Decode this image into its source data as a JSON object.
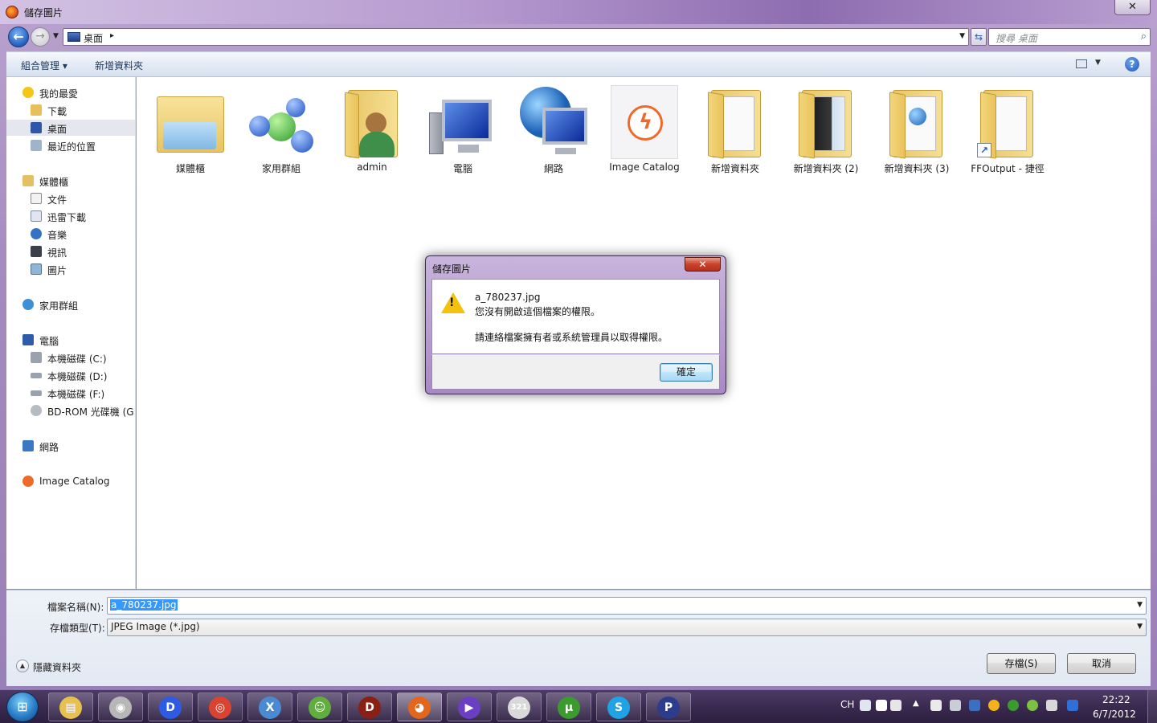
{
  "window": {
    "title": "儲存圖片",
    "close_glyph": "✕"
  },
  "navigation": {
    "back_glyph": "←",
    "forward_glyph": "→",
    "address": "桌面",
    "address_sep": "▸",
    "search_placeholder": "搜尋 桌面"
  },
  "toolbar": {
    "organize": "組合管理 ▾",
    "new_folder": "新增資料夾",
    "help": "?"
  },
  "sidebar": {
    "favorites": [
      {
        "label": "我的最愛",
        "icon": "star-icon"
      },
      {
        "label": "下載",
        "icon": "download-folder-icon"
      },
      {
        "label": "桌面",
        "icon": "desktop-icon",
        "selected": true
      },
      {
        "label": "最近的位置",
        "icon": "recent-places-icon"
      }
    ],
    "libraries": [
      {
        "label": "媒體櫃",
        "icon": "library-icon"
      },
      {
        "label": "文件",
        "icon": "documents-icon"
      },
      {
        "label": "迅雷下載",
        "icon": "thunder-download-icon"
      },
      {
        "label": "音樂",
        "icon": "music-icon"
      },
      {
        "label": "視訊",
        "icon": "video-icon"
      },
      {
        "label": "圖片",
        "icon": "pictures-icon"
      }
    ],
    "homegroup": {
      "label": "家用群組",
      "icon": "homegroup-icon"
    },
    "computer": [
      {
        "label": "電腦",
        "icon": "computer-icon"
      },
      {
        "label": "本機磁碟 (C:)",
        "icon": "drive-c-icon"
      },
      {
        "label": "本機磁碟 (D:)",
        "icon": "drive-d-icon"
      },
      {
        "label": "本機磁碟 (F:)",
        "icon": "drive-f-icon"
      },
      {
        "label": "BD-ROM 光碟機 (G:",
        "icon": "bd-rom-icon"
      }
    ],
    "network": {
      "label": "網路",
      "icon": "network-icon"
    },
    "image_catalog": {
      "label": "Image Catalog",
      "icon": "image-catalog-icon"
    }
  },
  "files": [
    {
      "label": "媒體櫃",
      "icon": "library-folder-icon"
    },
    {
      "label": "家用群組",
      "icon": "homegroup-icon"
    },
    {
      "label": "admin",
      "icon": "user-folder-icon"
    },
    {
      "label": "電腦",
      "icon": "computer-icon"
    },
    {
      "label": "網路",
      "icon": "network-icon"
    },
    {
      "label": "Image Catalog",
      "icon": "image-catalog-icon"
    },
    {
      "label": "新增資料夾",
      "icon": "folder-icon"
    },
    {
      "label": "新增資料夾 (2)",
      "icon": "folder-icon"
    },
    {
      "label": "新增資料夾 (3)",
      "icon": "folder-icon"
    },
    {
      "label": "FFOutput - 捷徑",
      "icon": "folder-shortcut-icon"
    }
  ],
  "save_form": {
    "filename_label": "檔案名稱(N):",
    "filename_value": "a_780237.jpg",
    "type_label": "存檔類型(T):",
    "type_value": "JPEG Image (*.jpg)",
    "hide_folders": "隱藏資料夾",
    "save_button": "存檔(S)",
    "cancel_button": "取消"
  },
  "dialog": {
    "title": "儲存圖片",
    "filename": "a_780237.jpg",
    "message": "您沒有開啟這個檔案的權限。",
    "detail": "請連絡檔案擁有者或系統管理員以取得權限。",
    "ok_button": "確定",
    "close_glyph": "✕",
    "warning_mark": "!"
  },
  "taskbar": {
    "start_glyph": "⊞",
    "apps": [
      {
        "name": "windows-explorer-icon",
        "glyph": "▤",
        "color": "#e8c04f"
      },
      {
        "name": "cleaning-app-icon",
        "glyph": "◉",
        "color": "#b7b7b7"
      },
      {
        "name": "media-player-d-icon",
        "glyph": "D",
        "color": "#2d5be3"
      },
      {
        "name": "chrome-icon",
        "glyph": "◎",
        "color": "#d9432f"
      },
      {
        "name": "x-app-icon",
        "glyph": "X",
        "color": "#4a8ad2"
      },
      {
        "name": "messenger-icon",
        "glyph": "☺",
        "color": "#5fae3e"
      },
      {
        "name": "diablo-icon",
        "glyph": "D",
        "color": "#8a1f14"
      },
      {
        "name": "firefox-icon",
        "glyph": "◕",
        "color": "#e3661d"
      },
      {
        "name": "video-player-icon",
        "glyph": "▶",
        "color": "#6a3fc4"
      },
      {
        "name": "clapperboard-321-icon",
        "glyph": "321",
        "color": "#d9d9d9"
      },
      {
        "name": "utorrent-icon",
        "glyph": "µ",
        "color": "#3c9b2f"
      },
      {
        "name": "skype-icon",
        "glyph": "S",
        "color": "#1fa3e6"
      },
      {
        "name": "pso2-icon",
        "glyph": "P",
        "color": "#2b3d8c"
      }
    ],
    "tray": {
      "lang": "CH",
      "time": "22:22",
      "date": "6/7/2012"
    }
  }
}
